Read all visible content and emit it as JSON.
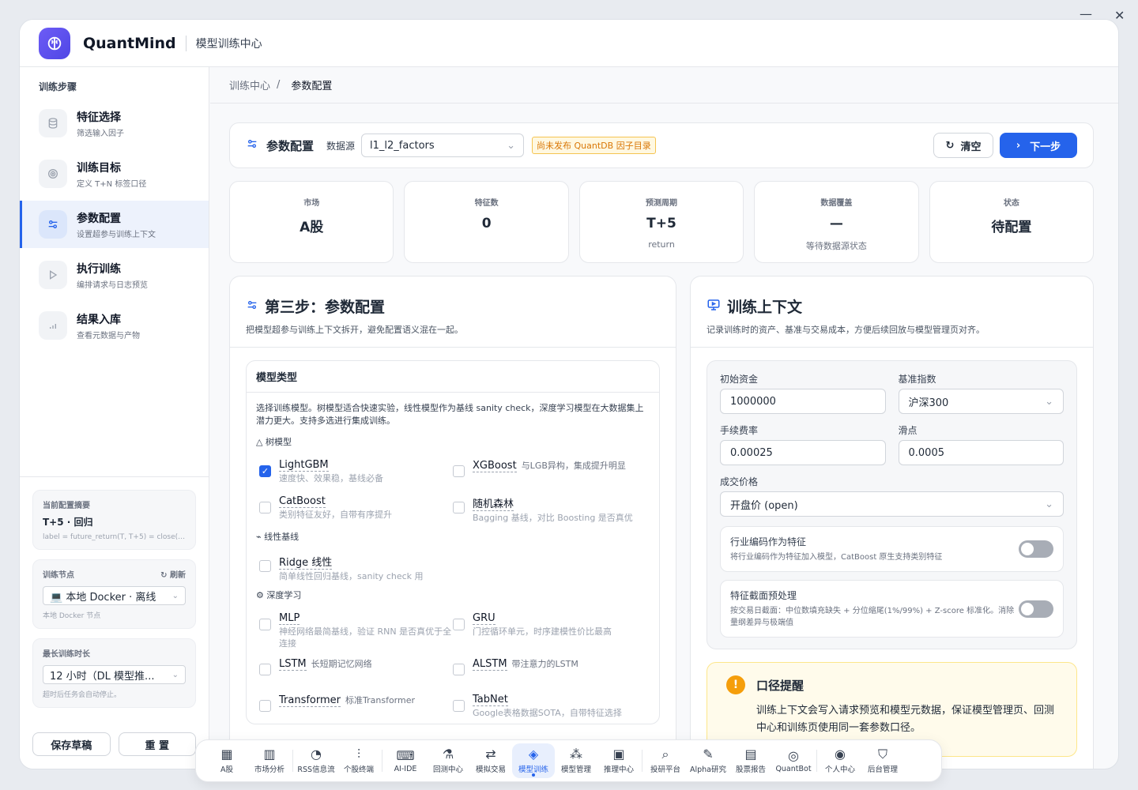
{
  "window": {
    "minimize": "—",
    "close": "✕"
  },
  "header": {
    "brand": "QuantMind",
    "subtitle": "模型训练中心"
  },
  "sidebar": {
    "title": "训练步骤",
    "steps": [
      {
        "label": "特征选择",
        "desc": "筛选输入因子",
        "icon": "database-icon"
      },
      {
        "label": "训练目标",
        "desc": "定义 T+N 标签口径",
        "icon": "target-icon"
      },
      {
        "label": "参数配置",
        "desc": "设置超参与训练上下文",
        "icon": "sliders-icon"
      },
      {
        "label": "执行训练",
        "desc": "编排请求与日志预览",
        "icon": "play-icon"
      },
      {
        "label": "结果入库",
        "desc": "查看元数据与产物",
        "icon": "bar-chart-icon"
      }
    ],
    "summary": {
      "title": "当前配置摘要",
      "value": "T+5 · 回归",
      "formula": "label = future_return(T, T+5) = close(T+..."
    },
    "node": {
      "title": "训练节点",
      "refresh": "刷新",
      "selected": "本地 Docker · 离线",
      "hint": "本地 Docker 节点"
    },
    "duration": {
      "title": "最长训练时长",
      "selected": "12 小时（DL 模型推...",
      "hint": "超时后任务会自动停止。"
    },
    "save_draft": "保存草稿",
    "reset": "重 置"
  },
  "breadcrumb": {
    "parent": "训练中心",
    "sep": "/",
    "current": "参数配置"
  },
  "toolbar": {
    "title": "参数配置",
    "source_label": "数据源",
    "source_value": "l1_l2_factors",
    "warning": "尚未发布 QuantDB 因子目录",
    "clear": "清空",
    "next": "下一步"
  },
  "stats": [
    {
      "label": "市场",
      "value": "A股",
      "sub": ""
    },
    {
      "label": "特征数",
      "value": "0",
      "sub": ""
    },
    {
      "label": "预测周期",
      "value": "T+5",
      "sub": "return"
    },
    {
      "label": "数据覆盖",
      "value": "—",
      "sub": "等待数据源状态"
    },
    {
      "label": "状态",
      "value": "待配置",
      "sub": ""
    }
  ],
  "left_panel": {
    "title": "第三步：参数配置",
    "desc": "把模型超参与训练上下文拆开，避免配置语义混在一起。",
    "model_type": {
      "title": "模型类型",
      "desc": "选择训练模型。树模型适合快速实验，线性模型作为基线 sanity check，深度学习模型在大数据集上潜力更大。支持多选进行集成训练。",
      "groups": {
        "tree": "树模型",
        "linear": "线性基线",
        "deep": "深度学习"
      },
      "tree": [
        {
          "name": "LightGBM",
          "inline": "",
          "desc": "速度快、效果稳，基线必备",
          "checked": true
        },
        {
          "name": "XGBoost",
          "inline": "与LGB异构，集成提升明显",
          "desc": "",
          "checked": false
        },
        {
          "name": "CatBoost",
          "inline": "",
          "desc": "类别特征友好，自带有序提升",
          "checked": false
        },
        {
          "name": "随机森林",
          "inline": "",
          "desc": "Bagging 基线，对比 Boosting 是否真优",
          "checked": false
        }
      ],
      "linear": [
        {
          "name": "Ridge 线性",
          "inline": "",
          "desc": "简单线性回归基线，sanity check 用",
          "checked": false
        }
      ],
      "deep": [
        {
          "name": "MLP",
          "inline": "",
          "desc": "神经网络最简基线，验证 RNN 是否真优于全连接",
          "checked": false
        },
        {
          "name": "GRU",
          "inline": "",
          "desc": "门控循环单元，时序建模性价比最高",
          "checked": false
        },
        {
          "name": "LSTM",
          "inline": "长短期记忆网络",
          "desc": "",
          "checked": false
        },
        {
          "name": "ALSTM",
          "inline": "带注意力的LSTM",
          "desc": "",
          "checked": false
        },
        {
          "name": "Transformer",
          "inline": "标准Transformer",
          "desc": "",
          "checked": false
        },
        {
          "name": "TabNet",
          "inline": "",
          "desc": "Google表格数据SOTA，自带特征选择",
          "checked": false
        }
      ]
    }
  },
  "right_panel": {
    "title": "训练上下文",
    "desc": "记录训练时的资产、基准与交易成本，方便后续回放与模型管理页对齐。",
    "fields": {
      "capital_label": "初始资金",
      "capital": "1000000",
      "benchmark_label": "基准指数",
      "benchmark": "沪深300",
      "fee_label": "手续费率",
      "fee": "0.00025",
      "slippage_label": "滑点",
      "slippage": "0.0005",
      "price_label": "成交价格",
      "price": "开盘价 (open)"
    },
    "toggle1": {
      "title": "行业编码作为特征",
      "desc": "将行业编码作为特征加入模型，CatBoost 原生支持类别特征",
      "on": false
    },
    "toggle2": {
      "title": "特征截面预处理",
      "desc": "按交易日截面：中位数填充缺失 + 分位缩尾(1%/99%) + Z-score 标准化。消除量纲差异与极端值",
      "on": false
    },
    "note": {
      "title": "口径提醒",
      "text": "训练上下文会写入请求预览和模型元数据，保证模型管理页、回测中心和训练页使用同一套参数口径。"
    }
  },
  "dock": [
    {
      "label": "A股",
      "icon": "grid-icon",
      "glyph": "▦"
    },
    {
      "label": "市场分析",
      "icon": "chart-icon",
      "glyph": "▥"
    },
    {
      "label": "RSS信息流",
      "icon": "rss-icon",
      "glyph": "◔"
    },
    {
      "label": "个股终端",
      "icon": "terminal-chart-icon",
      "glyph": "⫶"
    },
    {
      "label": "AI-IDE",
      "icon": "code-icon",
      "glyph": "⌨"
    },
    {
      "label": "回测中心",
      "icon": "flask-icon",
      "glyph": "⚗"
    },
    {
      "label": "模拟交易",
      "icon": "swap-icon",
      "glyph": "⇄"
    },
    {
      "label": "模型训练",
      "icon": "layers-icon",
      "glyph": "◈"
    },
    {
      "label": "模型管理",
      "icon": "boxes-icon",
      "glyph": "⁂"
    },
    {
      "label": "推理中心",
      "icon": "cpu-icon",
      "glyph": "▣"
    },
    {
      "label": "投研平台",
      "icon": "search-icon",
      "glyph": "⌕"
    },
    {
      "label": "Alpha研究",
      "icon": "pen-icon",
      "glyph": "✎"
    },
    {
      "label": "股票报告",
      "icon": "document-icon",
      "glyph": "▤"
    },
    {
      "label": "QuantBot",
      "icon": "bot-icon",
      "glyph": "◎"
    },
    {
      "label": "个人中心",
      "icon": "user-icon",
      "glyph": "◉"
    },
    {
      "label": "后台管理",
      "icon": "shield-icon",
      "glyph": "⛉"
    }
  ],
  "colors": {
    "accent": "#2563eb",
    "warning": "#d97706",
    "brand": "#5b4ef0"
  }
}
